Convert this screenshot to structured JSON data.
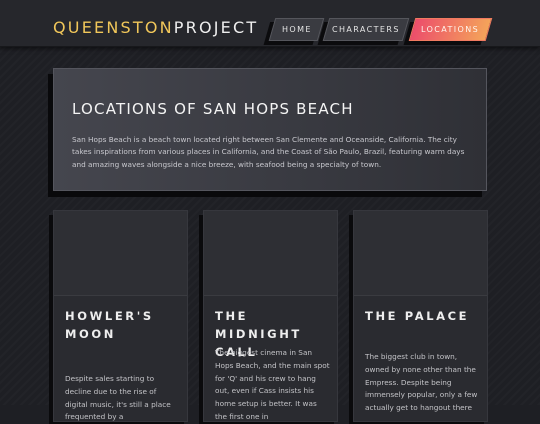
{
  "header": {
    "logo_part1": "QUEENSTON",
    "logo_part2": "PROJECT",
    "nav": [
      {
        "label": "HOME"
      },
      {
        "label": "CHARACTERS"
      },
      {
        "label": "LOCATIONS",
        "active": true
      }
    ]
  },
  "hero": {
    "title": "LOCATIONS OF SAN HOPS BEACH",
    "text": "San Hops Beach is a beach town located right between San Clemente and Oceanside, California. The city takes inspirations from various places in California, and the Coast of São Paulo, Brazil, featuring warm days and amazing waves alongside a nice breeze, with seafood being a specialty of town."
  },
  "cards": [
    {
      "title": "HOWLER'S MOON",
      "text": "Despite sales starting to decline due to the rise of digital music, it's still a place frequented by a"
    },
    {
      "title": "THE MIDNIGHT CALL",
      "text": "The biggest cinema in San Hops Beach, and the main spot for 'Q' and his crew to hang out, even if Cass insists his home setup is better. It was the first one in"
    },
    {
      "title": "THE PALACE",
      "text": "The biggest club in town, owned by none other than the Empress. Despite being immensely popular, only a few actually get to hangout there"
    }
  ],
  "colors": {
    "accent_gold": "#f1c75a",
    "active_gradient_start": "#ec4d6b",
    "active_gradient_end": "#f4a45a"
  }
}
